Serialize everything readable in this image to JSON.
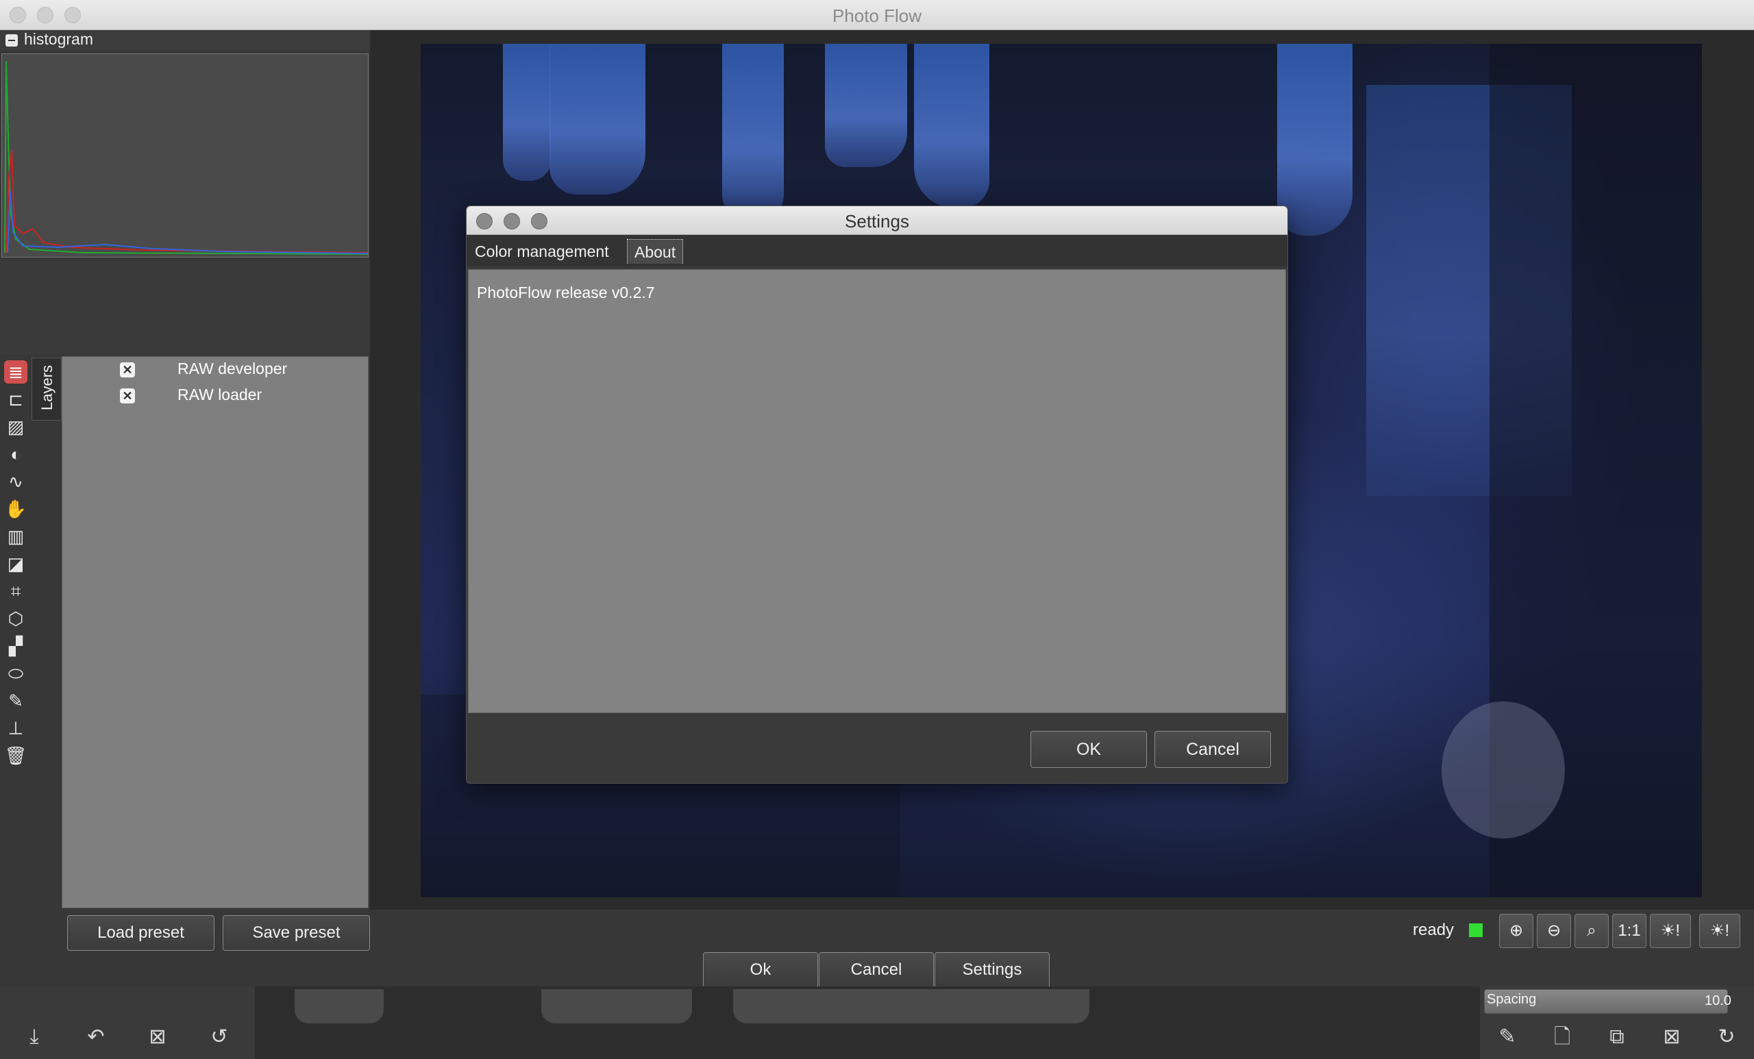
{
  "window": {
    "title": "Photo Flow"
  },
  "histogram": {
    "label": "histogram"
  },
  "layers": {
    "tab_label": "Layers",
    "items": [
      {
        "label": "RAW developer",
        "enabled": true
      },
      {
        "label": "RAW loader",
        "enabled": true
      }
    ]
  },
  "presets": {
    "load_label": "Load preset",
    "save_label": "Save preset"
  },
  "actions": {
    "ok_label": "Ok",
    "cancel_label": "Cancel",
    "settings_label": "Settings"
  },
  "status": {
    "text": "ready",
    "indicator_color": "#33dd33"
  },
  "zoom": {
    "one_to_one_label": "1:1"
  },
  "gimp_remnant": {
    "spacing_label": "Spacing",
    "spacing_value": "10.0"
  },
  "dialog": {
    "title": "Settings",
    "tabs": [
      {
        "label": "Color management",
        "active": false
      },
      {
        "label": "About",
        "active": true
      }
    ],
    "about_text": "PhotoFlow release v0.2.7",
    "ok_label": "OK",
    "cancel_label": "Cancel"
  },
  "icons": {
    "toolstrip": [
      "layers-icon",
      "group-icon",
      "image-icon",
      "contrast-icon",
      "curves-icon",
      "channel-mixer-icon",
      "gradient-icon",
      "invert-icon",
      "crop-icon",
      "perspective-icon",
      "draw-icon",
      "blur-icon",
      "brush-icon",
      "clone-icon",
      "trash-icon"
    ],
    "zoom": [
      "zoom-in-icon",
      "zoom-out-icon",
      "zoom-fit-icon",
      "zoom-1to1-icon",
      "shadows-clipping-icon",
      "highlights-clipping-icon"
    ]
  }
}
